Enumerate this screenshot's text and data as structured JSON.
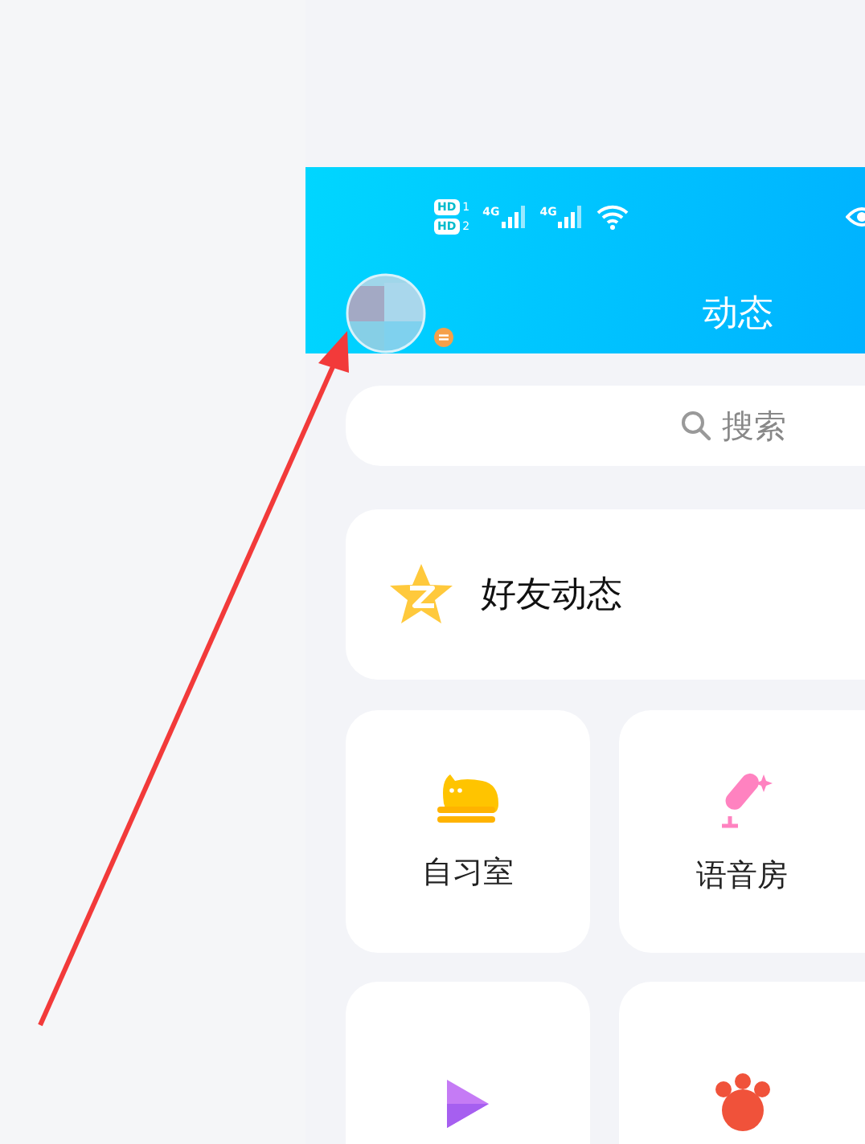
{
  "status_bar": {
    "sims": [
      {
        "badge": "HD",
        "slot": "1"
      },
      {
        "badge": "HD",
        "slot": "2"
      }
    ],
    "networks": [
      {
        "label": "4G"
      },
      {
        "label": "4G"
      }
    ]
  },
  "header": {
    "title": "动态"
  },
  "search": {
    "placeholder": "搜索"
  },
  "feed_card": {
    "label": "好友动态"
  },
  "tiles": [
    {
      "kind": "cat",
      "label": "自习室"
    },
    {
      "kind": "mic",
      "label": "语音房"
    },
    {
      "kind": "play"
    },
    {
      "kind": "paw"
    }
  ]
}
